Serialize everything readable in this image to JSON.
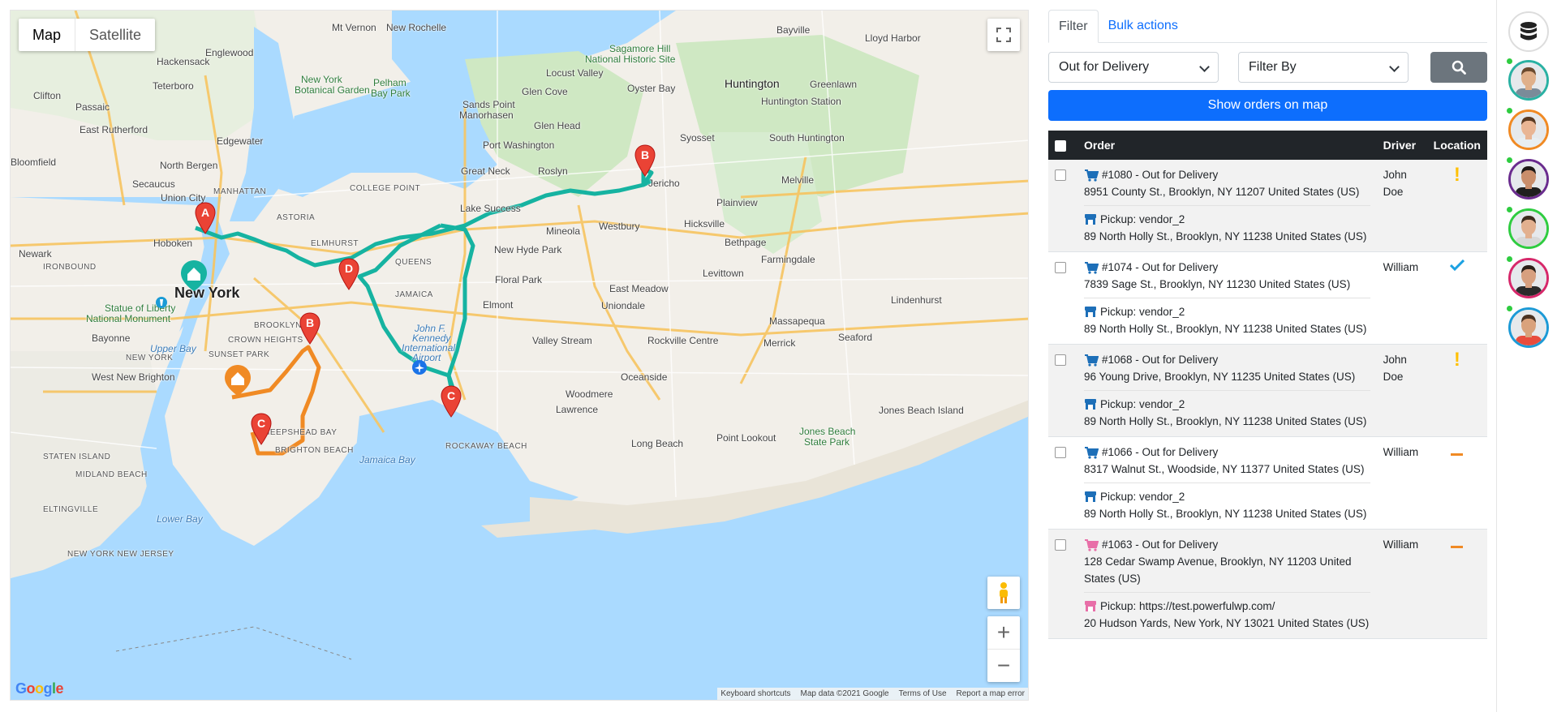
{
  "map": {
    "type_buttons": [
      "Map",
      "Satellite"
    ],
    "labels": [
      {
        "text": "Mt Vernon",
        "cls": ""
      },
      {
        "text": "New Rochelle",
        "cls": ""
      },
      {
        "text": "Bayville",
        "cls": ""
      },
      {
        "text": "Lloyd Harbor",
        "cls": ""
      },
      {
        "text": "Sagamore Hill",
        "cls": "park"
      },
      {
        "text": "National Historic Site",
        "cls": "park"
      },
      {
        "text": "Englewood",
        "cls": ""
      },
      {
        "text": "Hackensack",
        "cls": ""
      },
      {
        "text": "Clifton",
        "cls": ""
      },
      {
        "text": "Passaic",
        "cls": ""
      },
      {
        "text": "Teterboro",
        "cls": ""
      },
      {
        "text": "New York",
        "cls": "park"
      },
      {
        "text": "Botanical Garden",
        "cls": "park"
      },
      {
        "text": "Pelham",
        "cls": "park"
      },
      {
        "text": "Bay Park",
        "cls": "park"
      },
      {
        "text": "Locust Valley",
        "cls": ""
      },
      {
        "text": "Huntington",
        "cls": ""
      },
      {
        "text": "Greenlawn",
        "cls": ""
      },
      {
        "text": "East Rutherford",
        "cls": ""
      },
      {
        "text": "Edgewater",
        "cls": ""
      },
      {
        "text": "Glen Cove",
        "cls": ""
      },
      {
        "text": "Oyster Bay",
        "cls": ""
      },
      {
        "text": "Huntington Station",
        "cls": ""
      },
      {
        "text": "Sands Point",
        "cls": ""
      },
      {
        "text": "Manorhasen",
        "cls": ""
      },
      {
        "text": "Glen Head",
        "cls": ""
      },
      {
        "text": "Syosset",
        "cls": ""
      },
      {
        "text": "South Huntington",
        "cls": ""
      },
      {
        "text": "Bloomfield",
        "cls": ""
      },
      {
        "text": "North Bergen",
        "cls": ""
      },
      {
        "text": "Port Washington",
        "cls": ""
      },
      {
        "text": "Great Neck",
        "cls": ""
      },
      {
        "text": "Roslyn",
        "cls": ""
      },
      {
        "text": "Jericho",
        "cls": ""
      },
      {
        "text": "Melville",
        "cls": ""
      },
      {
        "text": "Secaucus",
        "cls": ""
      },
      {
        "text": "MANHATTAN",
        "cls": "caps"
      },
      {
        "text": "COLLEGE POINT",
        "cls": "caps"
      },
      {
        "text": "Union City",
        "cls": ""
      },
      {
        "text": "Plainview",
        "cls": ""
      },
      {
        "text": "Newark",
        "cls": ""
      },
      {
        "text": "Hoboken",
        "cls": ""
      },
      {
        "text": "ASTORIA",
        "cls": "caps"
      },
      {
        "text": "Lake Success",
        "cls": ""
      },
      {
        "text": "Westbury",
        "cls": ""
      },
      {
        "text": "Hicksville",
        "cls": ""
      },
      {
        "text": "Mineola",
        "cls": ""
      },
      {
        "text": "New Hyde Park",
        "cls": ""
      },
      {
        "text": "ELMHURST",
        "cls": "caps"
      },
      {
        "text": "QUEENS",
        "cls": "caps"
      },
      {
        "text": "Bethpage",
        "cls": ""
      },
      {
        "text": "Farmingdale",
        "cls": ""
      },
      {
        "text": "IRONBOUND",
        "cls": "caps"
      },
      {
        "text": "New York",
        "cls": "big"
      },
      {
        "text": "Floral Park",
        "cls": ""
      },
      {
        "text": "Levittown",
        "cls": ""
      },
      {
        "text": "JAMAICA",
        "cls": "caps"
      },
      {
        "text": "East Meadow",
        "cls": ""
      },
      {
        "text": "Statue of Liberty",
        "cls": "park"
      },
      {
        "text": "National Monument",
        "cls": "park"
      },
      {
        "text": "Elmont",
        "cls": ""
      },
      {
        "text": "Uniondale",
        "cls": ""
      },
      {
        "text": "Lindenhurst",
        "cls": ""
      },
      {
        "text": "John F.",
        "cls": "water"
      },
      {
        "text": "Kennedy",
        "cls": "water"
      },
      {
        "text": "International",
        "cls": "water"
      },
      {
        "text": "Airport",
        "cls": "water"
      },
      {
        "text": "Massapequa",
        "cls": ""
      },
      {
        "text": "Bayonne",
        "cls": ""
      },
      {
        "text": "BROOKLYN",
        "cls": "caps"
      },
      {
        "text": "CROWN HEIGHTS",
        "cls": "caps"
      },
      {
        "text": "Valley Stream",
        "cls": ""
      },
      {
        "text": "Rockville Centre",
        "cls": ""
      },
      {
        "text": "Merrick",
        "cls": ""
      },
      {
        "text": "Seaford",
        "cls": ""
      },
      {
        "text": "Upper Bay",
        "cls": "water"
      },
      {
        "text": "SUNSET PARK",
        "cls": "caps"
      },
      {
        "text": "NEW YORK",
        "cls": "caps"
      },
      {
        "text": "West New Brighton",
        "cls": ""
      },
      {
        "text": "Oceanside",
        "cls": ""
      },
      {
        "text": "Woodmere",
        "cls": ""
      },
      {
        "text": "Lawrence",
        "cls": ""
      },
      {
        "text": "Jones Beach Island",
        "cls": ""
      },
      {
        "text": "Jones Beach",
        "cls": "park"
      },
      {
        "text": "State Park",
        "cls": "park"
      },
      {
        "text": "Point Lookout",
        "cls": ""
      },
      {
        "text": "Long Beach",
        "cls": ""
      },
      {
        "text": "SHEEPSHEAD BAY",
        "cls": "caps"
      },
      {
        "text": "BRIGHTON BEACH",
        "cls": "caps"
      },
      {
        "text": "STATEN ISLAND",
        "cls": "caps"
      },
      {
        "text": "MIDLAND BEACH",
        "cls": "caps"
      },
      {
        "text": "Jamaica Bay",
        "cls": "water"
      },
      {
        "text": "ROCKAWAY BEACH",
        "cls": "caps"
      },
      {
        "text": "ELTINGVILLE",
        "cls": "caps"
      },
      {
        "text": "Lower Bay",
        "cls": "water"
      },
      {
        "text": "NEW YORK NEW JERSEY",
        "cls": "caps"
      }
    ],
    "markers": [
      {
        "letter": "A",
        "color": "#ea4335"
      },
      {
        "letter": "B",
        "color": "#ea4335"
      },
      {
        "letter": "C",
        "color": "#ea4335"
      },
      {
        "letter": "D",
        "color": "#ea4335"
      },
      {
        "letter": "B",
        "color": "#ea4335"
      },
      {
        "letter": "C",
        "color": "#ea4335"
      }
    ],
    "route_colors": {
      "teal": "#16b3a1",
      "orange": "#f08a24"
    },
    "attribution": [
      "Keyboard shortcuts",
      "Map data ©2021 Google",
      "Terms of Use",
      "Report a map error"
    ],
    "logo": "Google"
  },
  "panel": {
    "tabs": [
      "Filter",
      "Bulk actions"
    ],
    "status_select": "Out for Delivery",
    "filter_select": "Filter By",
    "show_button": "Show orders on map",
    "columns": [
      "Order",
      "Driver",
      "Location"
    ],
    "orders": [
      {
        "title": "#1080 - Out for Delivery",
        "address": "8951 County St., Brooklyn, NY 11207 United States (US)",
        "pickup": "Pickup: vendor_2",
        "pickup_address": "89 North Holly St., Brooklyn, NY 11238 United States (US)",
        "driver": "John Doe",
        "location": "warning",
        "cart_color": "#1d6fb8",
        "store_color": "#1d6fb8"
      },
      {
        "title": "#1074 - Out for Delivery",
        "address": "7839 Sage St., Brooklyn, NY 11230 United States (US)",
        "pickup": "Pickup: vendor_2",
        "pickup_address": "89 North Holly St., Brooklyn, NY 11238 United States (US)",
        "driver": "William",
        "location": "check",
        "cart_color": "#1d6fb8",
        "store_color": "#1d6fb8"
      },
      {
        "title": "#1068 - Out for Delivery",
        "address": "96 Young Drive, Brooklyn, NY 11235 United States (US)",
        "pickup": "Pickup: vendor_2",
        "pickup_address": "89 North Holly St., Brooklyn, NY 11238 United States (US)",
        "driver": "John Doe",
        "location": "warning",
        "cart_color": "#1d6fb8",
        "store_color": "#1d6fb8"
      },
      {
        "title": "#1066 - Out for Delivery",
        "address": "8317 Walnut St., Woodside, NY 11377 United States (US)",
        "pickup": "Pickup: vendor_2",
        "pickup_address": "89 North Holly St., Brooklyn, NY 11238 United States (US)",
        "driver": "William",
        "location": "dash",
        "cart_color": "#1d6fb8",
        "store_color": "#1d6fb8"
      },
      {
        "title": "#1063 - Out for Delivery",
        "address": "128 Cedar Swamp Avenue, Brooklyn, NY 11203 United States (US)",
        "pickup": "Pickup: https://test.powerfulwp.com/",
        "pickup_address": "20 Hudson Yards, New York, NY 13021 United States (US)",
        "driver": "William",
        "location": "dash",
        "cart_color": "#e86fa8",
        "store_color": "#e86fa8"
      }
    ]
  },
  "sidebar": {
    "drivers": [
      {
        "ring": "#2ab1a3",
        "skin": "#e0b08a",
        "hair": "#6b4a2e",
        "shirt": "#7a8b99"
      },
      {
        "ring": "#f08a24",
        "skin": "#e9b594",
        "hair": "#5a3a22",
        "shirt": "#e8eef2"
      },
      {
        "ring": "#6a2c8e",
        "skin": "#c98e6b",
        "hair": "#1e1a17",
        "shirt": "#1f1f1f"
      },
      {
        "ring": "#2ecc40",
        "skin": "#e2b08f",
        "hair": "#3b2a1c",
        "shirt": "#d8d8d8"
      },
      {
        "ring": "#d6286a",
        "skin": "#d7a07f",
        "hair": "#2b1f17",
        "shirt": "#2b2b2b"
      },
      {
        "ring": "#1c9ad6",
        "skin": "#d9a27c",
        "hair": "#4a3222",
        "shirt": "#e84c3d"
      }
    ]
  }
}
